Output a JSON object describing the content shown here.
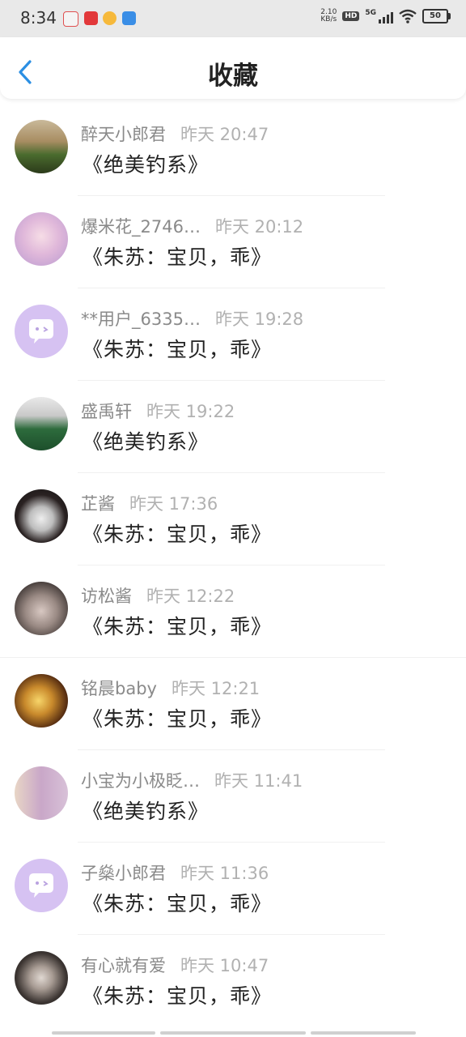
{
  "status_bar": {
    "time": "8:34",
    "speed_value": "2.10",
    "speed_unit": "KB/s",
    "hd": "HD",
    "network": "5G",
    "battery": "50"
  },
  "header": {
    "title": "收藏"
  },
  "items": [
    {
      "name": "醉天小郎君",
      "time": "昨天 20:47",
      "content": "《绝美钓系》"
    },
    {
      "name": "爆米花_2746…",
      "time": "昨天 20:12",
      "content": "《朱苏：宝贝，乖》"
    },
    {
      "name": "**用户_6335…",
      "time": "昨天 19:28",
      "content": "《朱苏：宝贝，乖》"
    },
    {
      "name": "盛禹轩",
      "time": "昨天 19:22",
      "content": "《绝美钓系》"
    },
    {
      "name": "芷酱",
      "time": "昨天 17:36",
      "content": "《朱苏：宝贝，乖》"
    },
    {
      "name": "访松酱",
      "time": "昨天 12:22",
      "content": "《朱苏：宝贝，乖》"
    },
    {
      "name": "铭晨baby",
      "time": "昨天 12:21",
      "content": "《朱苏：宝贝，乖》"
    },
    {
      "name": "小宝为小极眨…",
      "time": "昨天 11:41",
      "content": "《绝美钓系》"
    },
    {
      "name": "子燊小郎君",
      "time": "昨天 11:36",
      "content": "《朱苏：宝贝，乖》"
    },
    {
      "name": "有心就有爱",
      "time": "昨天 10:47",
      "content": "《朱苏：宝贝，乖》"
    }
  ]
}
